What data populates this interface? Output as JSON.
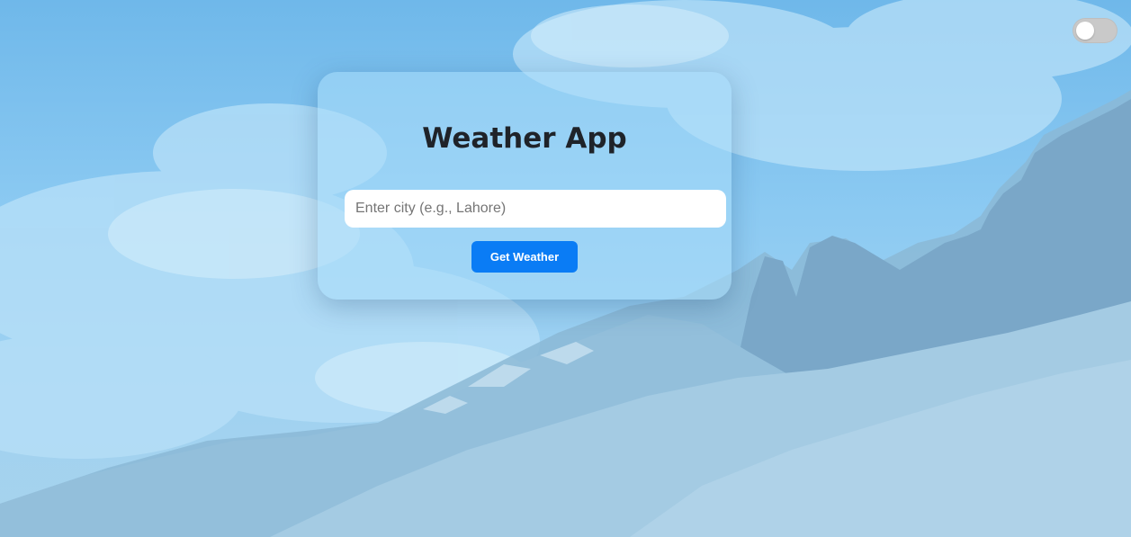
{
  "app": {
    "title": "Weather App"
  },
  "search": {
    "placeholder": "Enter city (e.g., Lahore)",
    "value": ""
  },
  "actions": {
    "get_weather_label": "Get Weather"
  },
  "theme_toggle": {
    "state": "off"
  },
  "colors": {
    "accent": "#0a7cf5",
    "card_tint": "#aadcfa",
    "sky": "#7fc3ef",
    "title_text": "#1f2329"
  }
}
